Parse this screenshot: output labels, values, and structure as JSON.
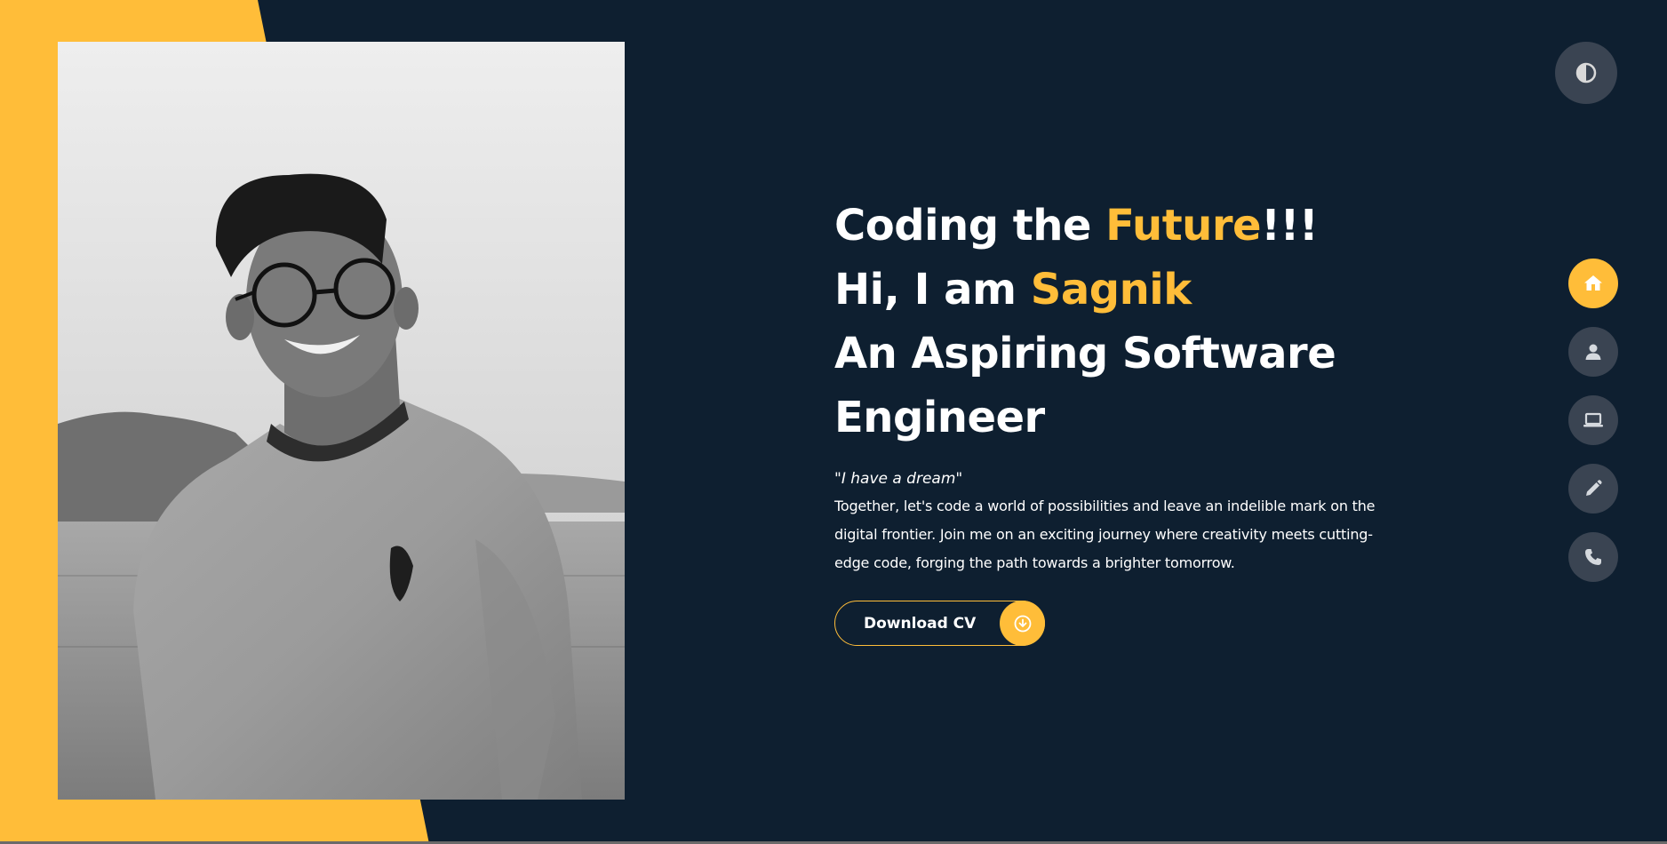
{
  "hero": {
    "line1_pre": "Coding the ",
    "line1_highlight": "Future",
    "line1_post": "!!!",
    "line2_pre": "Hi, I am ",
    "line2_highlight": "Sagnik",
    "line3": "An Aspiring Software",
    "line4": "Engineer",
    "quote_open": "\"",
    "quote_text": "I have a dream",
    "quote_close": "\"",
    "bio": "Together, let's code a world of possibilities and leave an indelible mark on the digital frontier. Join me on an exciting journey where creativity meets cutting-edge code, forging the path towards a brighter tomorrow."
  },
  "cv_button": {
    "label": "Download CV",
    "icon": "download-circle-icon"
  },
  "theme_toggle": {
    "icon": "contrast-icon"
  },
  "nav": {
    "items": [
      {
        "name": "home",
        "icon": "home-icon",
        "active": true
      },
      {
        "name": "about",
        "icon": "user-icon",
        "active": false
      },
      {
        "name": "portfolio",
        "icon": "laptop-icon",
        "active": false
      },
      {
        "name": "blog",
        "icon": "pencil-icon",
        "active": false
      },
      {
        "name": "contact",
        "icon": "phone-icon",
        "active": false
      }
    ]
  },
  "colors": {
    "background": "#0e1f30",
    "accent": "#ffbd39",
    "button_gray": "#3a4452",
    "text": "#ffffff"
  }
}
